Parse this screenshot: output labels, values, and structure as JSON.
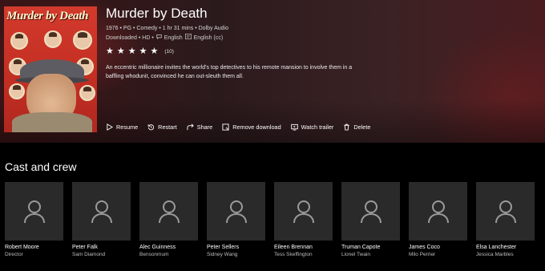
{
  "movie": {
    "poster_title": "Murder by Death",
    "title": "Murder by Death",
    "meta_line": "1976 • PG • Comedy • 1 hr 31 mins • Dolby Audio",
    "download_status": "Downloaded",
    "quality": "HD",
    "audio_language": "English",
    "subtitle_language": "English (cc)",
    "rating_stars": 5,
    "rating_count": "(10)",
    "description": "An eccentric millionaire invites the world's top detectives to his remote mansion to involve them in a baffling whodunit, convinced he can out-sleuth them all."
  },
  "actions": {
    "resume": "Resume",
    "restart": "Restart",
    "share": "Share",
    "remove_download": "Remove download",
    "watch_trailer": "Watch trailer",
    "delete": "Delete"
  },
  "cast_section": {
    "title": "Cast and crew",
    "people": [
      {
        "name": "Robert Moore",
        "role": "Director"
      },
      {
        "name": "Peter Falk",
        "role": "Sam Diamond"
      },
      {
        "name": "Alec Guinness",
        "role": "Bensonmum"
      },
      {
        "name": "Peter Sellers",
        "role": "Sidney Wang"
      },
      {
        "name": "Eileen Brennan",
        "role": "Tess Skeffington"
      },
      {
        "name": "Truman Capote",
        "role": "Lionel Twain"
      },
      {
        "name": "James Coco",
        "role": "Milo Perrier"
      },
      {
        "name": "Elsa Lanchester",
        "role": "Jessica Marbles"
      }
    ]
  },
  "icons": {
    "audio": "speech-bubble-icon",
    "subtitles": "closed-caption-icon",
    "person_placeholder": "person-icon"
  }
}
